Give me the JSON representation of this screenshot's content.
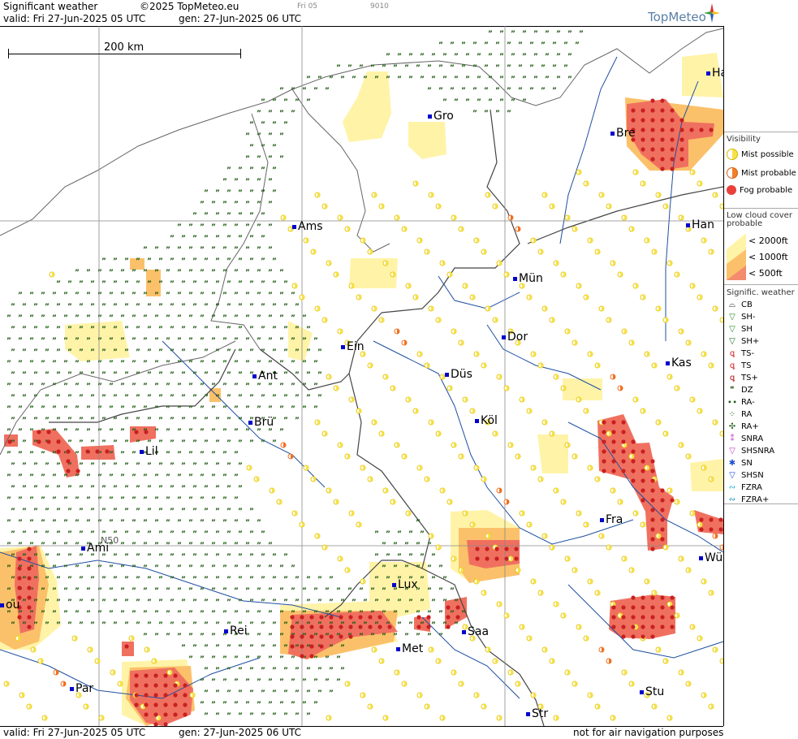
{
  "header": {
    "title": "Significant weather",
    "copyright": "©2025 TopMeteo.eu",
    "run": "Fri 05",
    "code": "9010",
    "valid": "valid:  Fri  27-Jun-2025  05 UTC",
    "gen": "gen: 27-Jun-2025 06 UTC",
    "brand": "TopMeteo"
  },
  "footer": {
    "valid": "valid:  Fri  27-Jun-2025  05 UTC",
    "gen": "gen: 27-Jun-2025 06 UTC",
    "disclaimer": "not for air navigation purposes"
  },
  "map": {
    "scale_label": "200 km",
    "latitude_label": "N50",
    "cities": [
      {
        "name": "Gro"
      },
      {
        "name": "Bre"
      },
      {
        "name": "Ha"
      },
      {
        "name": "Ams"
      },
      {
        "name": "Han"
      },
      {
        "name": "Mün"
      },
      {
        "name": "Ein"
      },
      {
        "name": "Dor"
      },
      {
        "name": "Ant"
      },
      {
        "name": "Düs"
      },
      {
        "name": "Kas"
      },
      {
        "name": "Brü"
      },
      {
        "name": "Köl"
      },
      {
        "name": "Lil"
      },
      {
        "name": "Fra"
      },
      {
        "name": "Ami"
      },
      {
        "name": "Wü"
      },
      {
        "name": "Lux"
      },
      {
        "name": "ou"
      },
      {
        "name": "Rei"
      },
      {
        "name": "Saa"
      },
      {
        "name": "Met"
      },
      {
        "name": "Stu"
      },
      {
        "name": "Par"
      },
      {
        "name": "Str"
      }
    ]
  },
  "legend": {
    "visibility_title": "Visibility",
    "visibility": [
      {
        "label": "Mist possible",
        "color": "#f7e24a"
      },
      {
        "label": "Mist probable",
        "color": "#f2802a"
      },
      {
        "label": "Fog probable",
        "color": "#e8403a"
      }
    ],
    "lowcloud_title_1": "Low cloud cover",
    "lowcloud_title_2": "probable",
    "lowcloud": [
      {
        "label": "< 2000ft",
        "color": "#fff3a8"
      },
      {
        "label": "< 1000ft",
        "color": "#fbc16a"
      },
      {
        "label": "<   500ft",
        "color": "#f48a6e"
      }
    ],
    "weather_title": "Signific. weather",
    "weather": [
      {
        "label": "CB",
        "icon": "cb-icon"
      },
      {
        "label": "SH-",
        "icon": "shower-light-icon"
      },
      {
        "label": "SH",
        "icon": "shower-icon"
      },
      {
        "label": "SH+",
        "icon": "shower-heavy-icon"
      },
      {
        "label": "TS-",
        "icon": "thunder-light-icon"
      },
      {
        "label": "TS",
        "icon": "thunder-icon"
      },
      {
        "label": "TS+",
        "icon": "thunder-heavy-icon"
      },
      {
        "label": "DZ",
        "icon": "drizzle-icon"
      },
      {
        "label": "RA-",
        "icon": "rain-light-icon"
      },
      {
        "label": "RA",
        "icon": "rain-icon"
      },
      {
        "label": "RA+",
        "icon": "rain-heavy-icon"
      },
      {
        "label": "SNRA",
        "icon": "sleet-icon"
      },
      {
        "label": "SHSNRA",
        "icon": "sleet-shower-icon"
      },
      {
        "label": "SN",
        "icon": "snow-icon"
      },
      {
        "label": "SHSN",
        "icon": "snow-shower-icon"
      },
      {
        "label": "FZRA",
        "icon": "freezing-rain-icon"
      },
      {
        "label": "FZRA+",
        "icon": "freezing-rain-heavy-icon"
      }
    ]
  }
}
